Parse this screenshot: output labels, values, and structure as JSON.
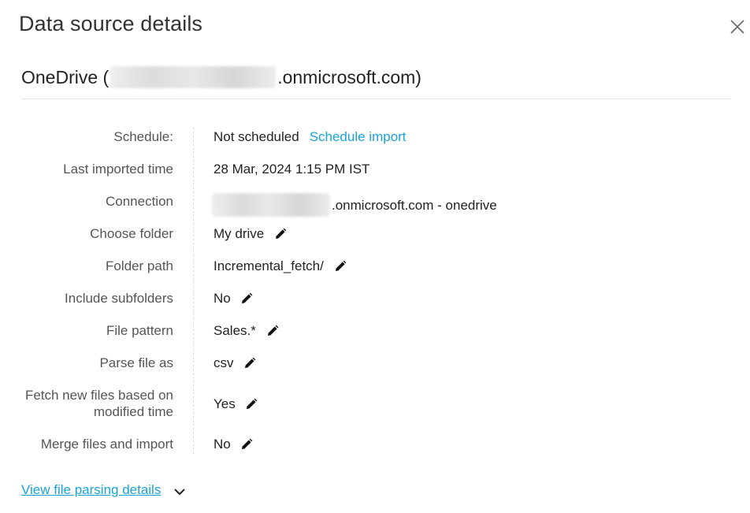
{
  "dialog": {
    "title": "Data source details"
  },
  "source": {
    "prefix": "OneDrive (",
    "suffix": ".onmicrosoft.com)"
  },
  "details": {
    "schedule_label": "Schedule:",
    "schedule_value": "Not scheduled",
    "schedule_link": "Schedule import",
    "last_imported_label": "Last imported time",
    "last_imported_value": "28 Mar, 2024 1:15 PM IST",
    "connection_label": "Connection",
    "connection_suffix": ".onmicrosoft.com - onedrive",
    "choose_folder_label": "Choose folder",
    "choose_folder_value": "My drive",
    "folder_path_label": "Folder path",
    "folder_path_value": "Incremental_fetch/",
    "include_subfolders_label": "Include subfolders",
    "include_subfolders_value": "No",
    "file_pattern_label": "File pattern",
    "file_pattern_value": "Sales.*",
    "parse_file_label": "Parse file as",
    "parse_file_value": "csv",
    "fetch_new_label": "Fetch new files based on modified time",
    "fetch_new_value": "Yes",
    "merge_files_label": "Merge files and import",
    "merge_files_value": "No"
  },
  "footer": {
    "view_parsing_link": "View file parsing details"
  },
  "icons": {
    "close": "close-icon",
    "edit": "pencil-icon",
    "expand": "chevron-down-icon"
  },
  "colors": {
    "link": "#1aa3d8",
    "label": "#555555",
    "text": "#222222"
  }
}
